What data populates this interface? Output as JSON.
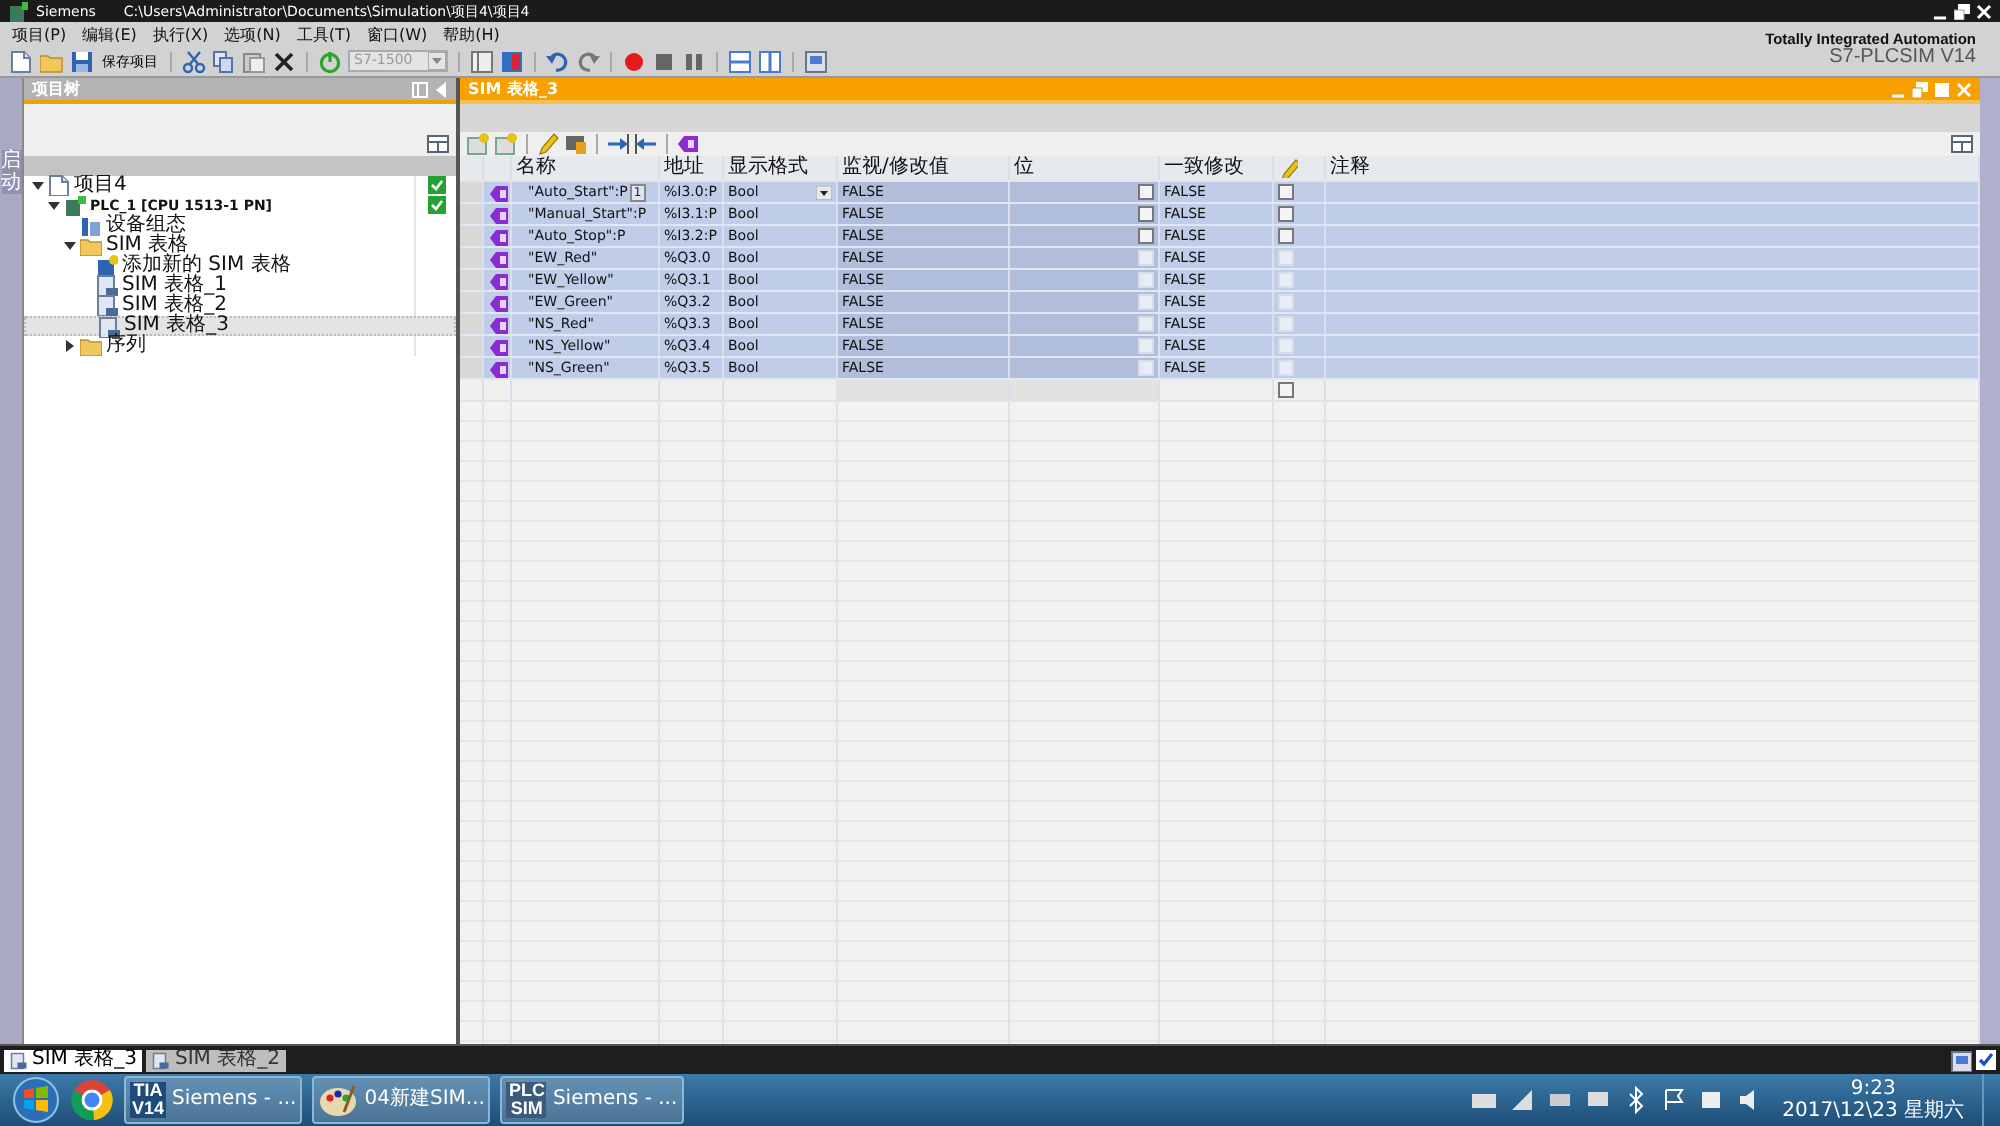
{
  "window": {
    "app": "Siemens",
    "path": "C:\\Users\\Administrator\\Documents\\Simulation\\项目4\\项目4"
  },
  "menu": [
    "项目(P)",
    "编辑(E)",
    "执行(X)",
    "选项(N)",
    "工具(T)",
    "窗口(W)",
    "帮助(H)"
  ],
  "toolbar": {
    "save_label": "保存项目",
    "device": "S7-1500"
  },
  "brand": {
    "line1": "Totally Integrated Automation",
    "line2": "S7-PLCSIM V14"
  },
  "side_strip": {
    "label": "启动"
  },
  "project_tree": {
    "title": "项目树",
    "items": [
      {
        "label": "项目4",
        "kind": "project",
        "expanded": true,
        "ok": true,
        "selected": false,
        "children": [
          {
            "label": "PLC_1 [CPU 1513-1 PN]",
            "kind": "plc",
            "expanded": true,
            "ok": true,
            "selected": false,
            "bold": true,
            "children": [
              {
                "label": "设备组态",
                "kind": "device",
                "selected": false
              },
              {
                "label": "SIM 表格",
                "kind": "folder",
                "expanded": true,
                "selected": false,
                "children": [
                  {
                    "label": "添加新的 SIM 表格",
                    "kind": "add",
                    "selected": false
                  },
                  {
                    "label": "SIM 表格_1",
                    "kind": "table",
                    "selected": false
                  },
                  {
                    "label": "SIM 表格_2",
                    "kind": "table",
                    "selected": false
                  },
                  {
                    "label": "SIM 表格_3",
                    "kind": "table",
                    "selected": true
                  }
                ]
              },
              {
                "label": "序列",
                "kind": "folder",
                "expanded": false,
                "selected": false
              }
            ]
          }
        ]
      }
    ]
  },
  "editor": {
    "title": "SIM 表格_3",
    "columns": [
      {
        "kind": "icon"
      },
      {
        "kind": "text",
        "label": "名称"
      },
      {
        "kind": "text",
        "label": "地址"
      },
      {
        "kind": "text",
        "label": "显示格式"
      },
      {
        "kind": "text",
        "label": "监视/修改值"
      },
      {
        "kind": "text",
        "label": "位"
      },
      {
        "kind": "text",
        "label": "一致修改"
      },
      {
        "kind": "trigger"
      },
      {
        "kind": "text",
        "label": "注释"
      }
    ],
    "rows": [
      {
        "name": "\"Auto_Start\":P",
        "marker": "1",
        "address": "%I3.0:P",
        "format": "Bool",
        "dropdown": true,
        "value": "FALSE",
        "consistent": "FALSE",
        "editable": true,
        "bit_checked": false,
        "trigger_checked": false,
        "selected": true
      },
      {
        "name": "\"Manual_Start\":P",
        "address": "%I3.1:P",
        "format": "Bool",
        "value": "FALSE",
        "consistent": "FALSE",
        "editable": true,
        "bit_checked": false,
        "trigger_checked": false,
        "selected": true
      },
      {
        "name": "\"Auto_Stop\":P",
        "address": "%I3.2:P",
        "format": "Bool",
        "value": "FALSE",
        "consistent": "FALSE",
        "editable": true,
        "bit_checked": false,
        "trigger_checked": false,
        "selected": true
      },
      {
        "name": "\"EW_Red\"",
        "address": "%Q3.0",
        "format": "Bool",
        "value": "FALSE",
        "consistent": "FALSE",
        "editable": false,
        "bit_checked": false,
        "trigger_checked": false,
        "selected": true
      },
      {
        "name": "\"EW_Yellow\"",
        "address": "%Q3.1",
        "format": "Bool",
        "value": "FALSE",
        "consistent": "FALSE",
        "editable": false,
        "bit_checked": false,
        "trigger_checked": false,
        "selected": true
      },
      {
        "name": "\"EW_Green\"",
        "address": "%Q3.2",
        "format": "Bool",
        "value": "FALSE",
        "consistent": "FALSE",
        "editable": false,
        "bit_checked": false,
        "trigger_checked": false,
        "selected": true
      },
      {
        "name": "\"NS_Red\"",
        "address": "%Q3.3",
        "format": "Bool",
        "value": "FALSE",
        "consistent": "FALSE",
        "editable": false,
        "bit_checked": false,
        "trigger_checked": false,
        "selected": true
      },
      {
        "name": "\"NS_Yellow\"",
        "address": "%Q3.4",
        "format": "Bool",
        "value": "FALSE",
        "consistent": "FALSE",
        "editable": false,
        "bit_checked": false,
        "trigger_checked": false,
        "selected": true
      },
      {
        "name": "\"NS_Green\"",
        "address": "%Q3.5",
        "format": "Bool",
        "value": "FALSE",
        "consistent": "FALSE",
        "editable": false,
        "bit_checked": false,
        "trigger_checked": false,
        "selected": true
      }
    ]
  },
  "empty_row": {
    "trigger_checked": false
  },
  "status_bar": {
    "option_checked": true
  },
  "editor_tabs": [
    {
      "label": "SIM 表格_3",
      "selected": true
    },
    {
      "label": "SIM 表格_2",
      "selected": false
    }
  ],
  "taskbar": {
    "apps": [
      {
        "kind": "tia",
        "badge": [
          "TIA",
          "V14"
        ],
        "label": "Siemens - ..."
      },
      {
        "kind": "paint",
        "label": "04新建SIM..."
      },
      {
        "kind": "plcsim",
        "badge": [
          "PLC",
          "SIM"
        ],
        "label": "Siemens - ..."
      }
    ],
    "time": "9:23",
    "date": "2017\\12\\23 星期六"
  }
}
